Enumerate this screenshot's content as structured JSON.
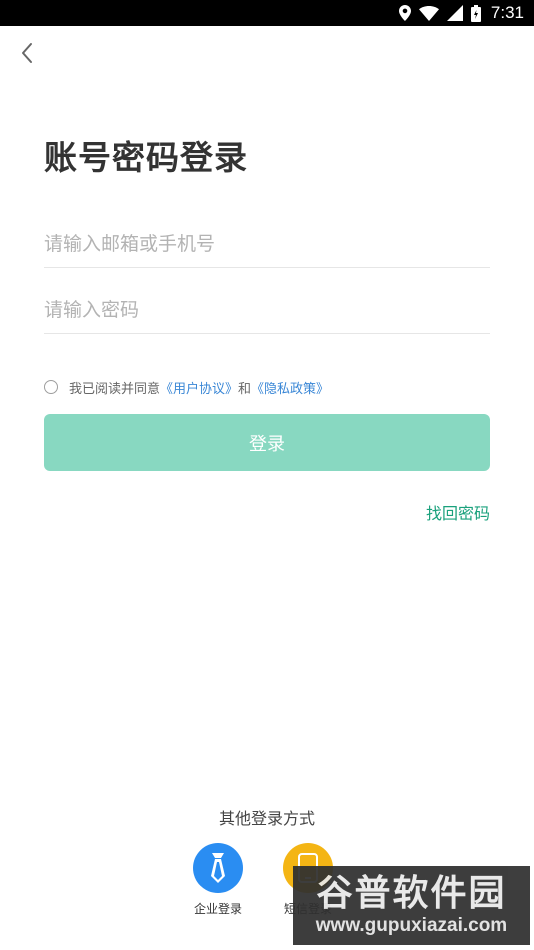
{
  "status_bar": {
    "time": "7:31",
    "icons": [
      "location-icon",
      "wifi-icon",
      "signal-icon",
      "battery-icon"
    ]
  },
  "header": {
    "back_icon": "chevron-left-icon",
    "title": "账号密码登录"
  },
  "form": {
    "account_placeholder": "请输入邮箱或手机号",
    "account_value": "",
    "password_placeholder": "请输入密码",
    "password_value": ""
  },
  "agreement": {
    "prefix": "我已阅读并同意",
    "user_agreement": "《用户协议》",
    "conjunction": "和",
    "privacy_policy": "《隐私政策》",
    "checked": false
  },
  "login_button": "登录",
  "forgot_password": "找回密码",
  "other_login": {
    "title": "其他登录方式",
    "methods": [
      {
        "label": "企业登录",
        "icon": "tie-icon",
        "color": "#2a8df2"
      },
      {
        "label": "短信登录",
        "icon": "phone-icon",
        "color": "#f4b514"
      }
    ]
  },
  "watermark": {
    "title": "谷普软件园",
    "url": "www.gupuxiazai.com"
  },
  "colors": {
    "accent": "#88d8c1",
    "link": "#3a87d6",
    "forgot": "#1aa17c"
  }
}
